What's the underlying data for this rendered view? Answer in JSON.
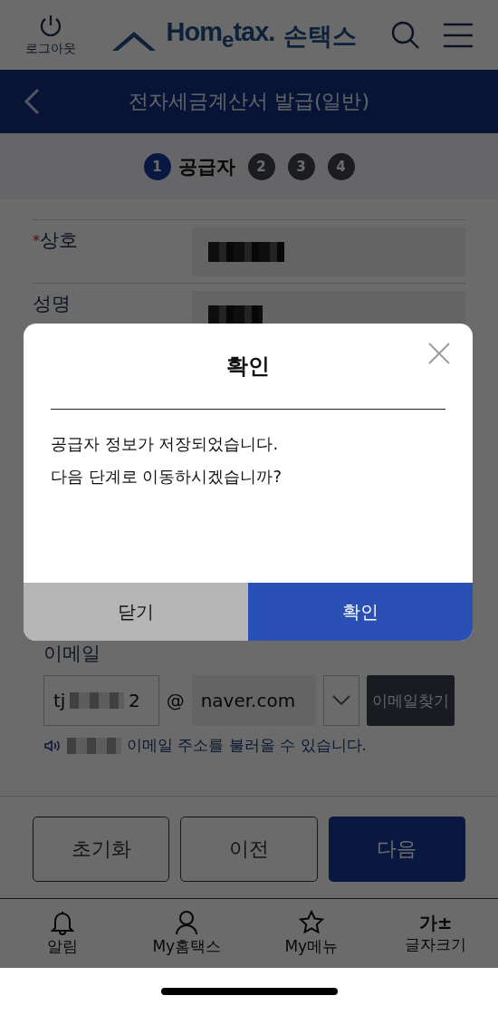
{
  "header": {
    "logout_label": "로그아웃",
    "logo_text": "Hom$_{e}$tax.",
    "app_name": "손택스"
  },
  "title_bar": {
    "title": "전자세금계산서 발급(일반)"
  },
  "steps": [
    {
      "number": "1",
      "label": "공급자",
      "selected": true
    },
    {
      "number": "2",
      "selected": false
    },
    {
      "number": "3",
      "selected": false
    },
    {
      "number": "4",
      "selected": false
    }
  ],
  "form": {
    "rows": [
      {
        "mark": "*",
        "label": "상호"
      },
      {
        "label": "성명"
      }
    ],
    "email": {
      "label": "이메일",
      "local_start": "tj",
      "local_end": "2",
      "at": "@",
      "domain": "naver.com",
      "find_button": "이메일찾기",
      "notice": "이메일 주소를 불러올 수 있습니다."
    }
  },
  "actions": [
    {
      "label": "초기화",
      "kind": "outline"
    },
    {
      "label": "이전",
      "kind": "outline"
    },
    {
      "label": "다음",
      "kind": "primary"
    }
  ],
  "bottom_nav": [
    {
      "label": "알림"
    },
    {
      "label": "My홈택스"
    },
    {
      "label": "My메뉴"
    },
    {
      "label": "글자크기",
      "glyph": "가±"
    }
  ],
  "dialog": {
    "title": "확인",
    "message": [
      "공급자 정보가 저장되었습니다.",
      "다음 단계로 이동하시겠습니까?"
    ],
    "buttons": [
      {
        "label": "닫기",
        "kind": "secondary"
      },
      {
        "label": "확인",
        "kind": "primary"
      }
    ]
  }
}
